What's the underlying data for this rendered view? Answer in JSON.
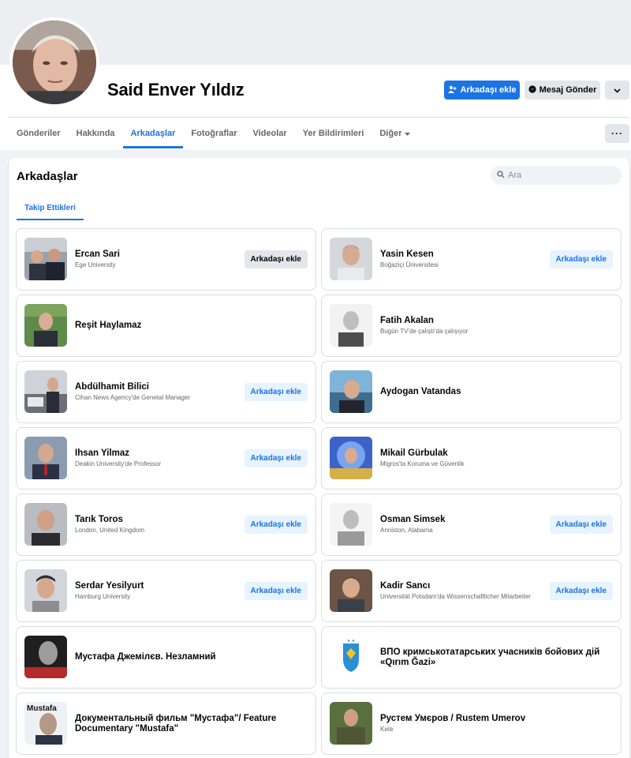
{
  "profile": {
    "name": "Said Enver Yıldız",
    "add_friend_label": "Arkadaşı ekle",
    "message_label": "Mesaj Gönder"
  },
  "nav": {
    "tabs": [
      {
        "label": "Gönderiler",
        "active": false
      },
      {
        "label": "Hakkında",
        "active": false
      },
      {
        "label": "Arkadaşlar",
        "active": true
      },
      {
        "label": "Fotoğraflar",
        "active": false
      },
      {
        "label": "Videolar",
        "active": false
      },
      {
        "label": "Yer Bildirimleri",
        "active": false
      },
      {
        "label": "Diğer",
        "active": false
      }
    ],
    "more_label": "···"
  },
  "friends_section": {
    "title": "Arkadaşlar",
    "search_placeholder": "Ara",
    "subtab_label": "Takip Ettikleri",
    "cards": [
      {
        "name": "Ercan Sari",
        "subtitle": "Ege University",
        "button": "Arkadaşı ekle"
      },
      {
        "name": "Yasin Kesen",
        "subtitle": "Boğaziçi Üniversitesi",
        "button": "Arkadaşı ekle"
      },
      {
        "name": "Reşit Haylamaz",
        "subtitle": "",
        "button": ""
      },
      {
        "name": "Fatih Akalan",
        "subtitle": "Bugün TV'de çalıştı'da çalışıyor",
        "button": ""
      },
      {
        "name": "Abdülhamit Bilici",
        "subtitle": "Cihan News Agency'de Genetal Manager",
        "button": "Arkadaşı ekle"
      },
      {
        "name": "Aydogan Vatandas",
        "subtitle": "",
        "button": ""
      },
      {
        "name": "Ihsan Yilmaz",
        "subtitle": "Deakin University'de Professor",
        "button": "Arkadaşı ekle"
      },
      {
        "name": "Mikail Gürbulak",
        "subtitle": "Migros'ta Koruma ve Güvenlik",
        "button": ""
      },
      {
        "name": "Tarık Toros",
        "subtitle": "London, United Kingdom",
        "button": "Arkadaşı ekle"
      },
      {
        "name": "Osman Simsek",
        "subtitle": "Anniston, Alabama",
        "button": "Arkadaşı ekle"
      },
      {
        "name": "Serdar Yesilyurt",
        "subtitle": "Hamburg University",
        "button": "Arkadaşı ekle"
      },
      {
        "name": "Kadir Sancı",
        "subtitle": "Universität Potsdam'da Wissenschaftlicher Mitarbeiter",
        "button": "Arkadaşı ekle"
      },
      {
        "name": "Мустафа Джемілєв. Незламний",
        "subtitle": "",
        "button": ""
      },
      {
        "name": "ВПО кримськотатарських учасників бойових дій «Qırım Ğazi»",
        "subtitle": "",
        "button": ""
      },
      {
        "name": "Документальный фильм \"Мустафа\"/ Feature Documentary \"Mustafa\"",
        "subtitle": "",
        "button": ""
      },
      {
        "name": "Рустем Умєров / Rustem Umerov",
        "subtitle": "Kиїв",
        "button": ""
      }
    ]
  },
  "thumb_caption": "Mustafa",
  "colors": {
    "accent": "#1b74e4",
    "light_accent": "#e7f3ff",
    "gray_button": "#e4e6eb"
  }
}
